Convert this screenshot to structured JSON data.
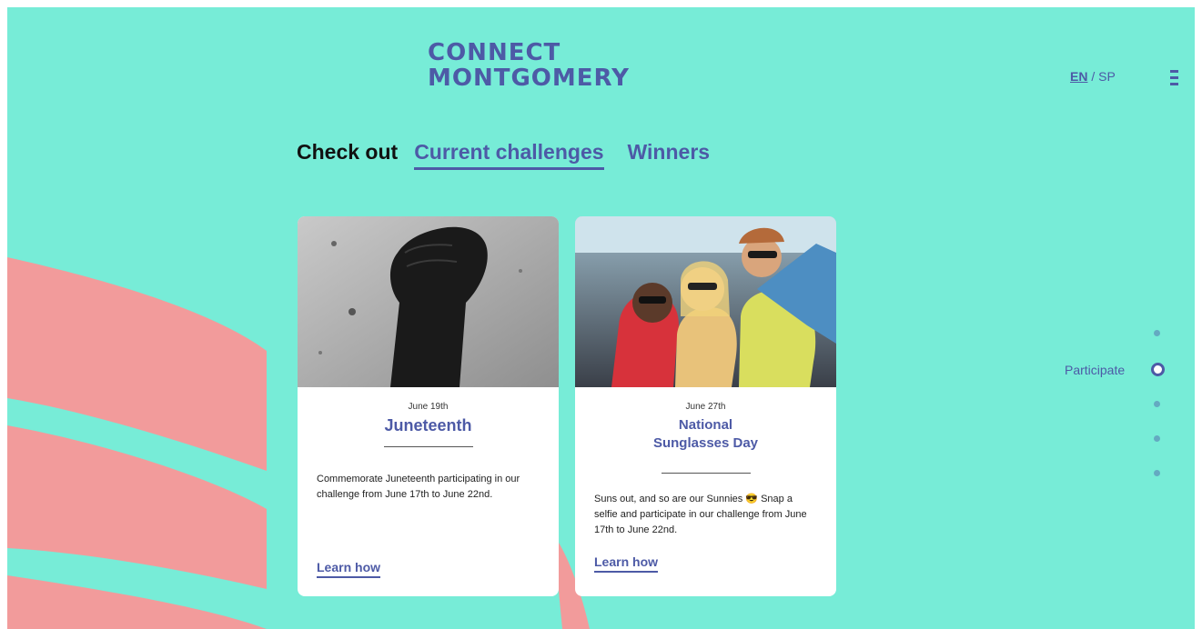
{
  "brand": {
    "line1": "CONNECT",
    "line2": "MONTGOMERY",
    "color": "#4d5aa6",
    "background": "#77ecd7",
    "stripe_color": "#f29b9b"
  },
  "lang": {
    "en": "EN",
    "separator": "/",
    "sp": "SP"
  },
  "menu": {
    "icon": "hamburger-menu-icon"
  },
  "nav": {
    "lead": "Check out",
    "tabs": [
      {
        "label": "Current challenges",
        "active": true
      },
      {
        "label": "Winners",
        "active": false
      }
    ]
  },
  "cards": [
    {
      "image": "raised-fist-photo",
      "date": "June 19th",
      "title": "Juneteenth",
      "description": "Commemorate Juneteenth participating in our challenge from June 17th to June 22nd.",
      "link": "Learn how"
    },
    {
      "image": "friends-sunglasses-car-photo",
      "date": "June 27th",
      "title_line1": "National",
      "title_line2": "Sunglasses Day",
      "description": "Suns out, and so are our Sunnies 😎 Snap a selfie and participate in our challenge from June 17th to June 22nd.",
      "link": "Learn how"
    }
  ],
  "side_nav": {
    "active_label": "Participate",
    "active_index": 1,
    "count": 5
  }
}
